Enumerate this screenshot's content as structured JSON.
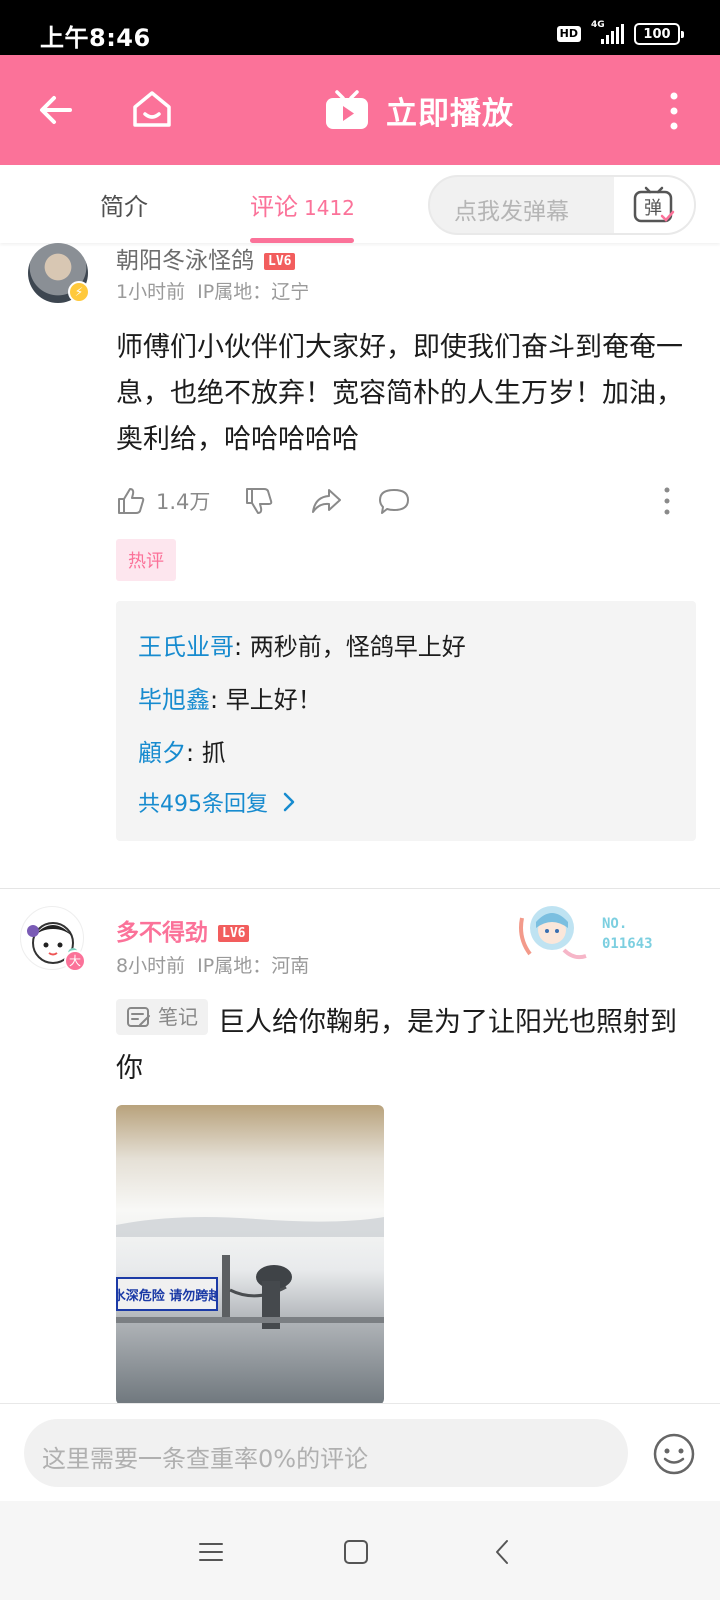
{
  "status_bar": {
    "time": "上午8:46",
    "hd": "HD",
    "network": "4G",
    "battery": "100"
  },
  "header": {
    "title": "立即播放",
    "accent_color": "#fb7299"
  },
  "tabs": {
    "intro": "简介",
    "comments": "评论",
    "comments_count": "1412",
    "danmaku_placeholder": "点我发弹幕",
    "danmaku_icon_label": "弹"
  },
  "comments": [
    {
      "username": "朝阳冬泳怪鸽",
      "level": "LV6",
      "time": "1小时前",
      "location": "IP属地：辽宁",
      "text": "师傅们小伙伴们大家好，即使我们奋斗到奄奄一息，也绝不放弃！宽容简朴的人生万岁！加油，奥利给，哈哈哈哈哈",
      "likes": "1.4万",
      "tag": "热评",
      "replies": [
        {
          "name": "王氏业哥",
          "text": ": 两秒前，怪鸽早上好"
        },
        {
          "name": "毕旭鑫",
          "text": ": 早上好！"
        },
        {
          "name": "顧夕",
          "text": ": 抓"
        }
      ],
      "replies_more": "共495条回复"
    },
    {
      "username": "多不得劲",
      "level": "LV6",
      "time": "8小时前",
      "location": "IP属地：河南",
      "note_tag": "笔记",
      "text": "巨人给你鞠躬，是为了让阳光也照射到你",
      "fan_badge_no": "NO.",
      "fan_badge_num": "011643",
      "avatar_badge": "大",
      "photo_sign": "水深危险 请勿跨越"
    }
  ],
  "bottom_input": {
    "placeholder": "这里需要一条查重率0%的评论"
  }
}
